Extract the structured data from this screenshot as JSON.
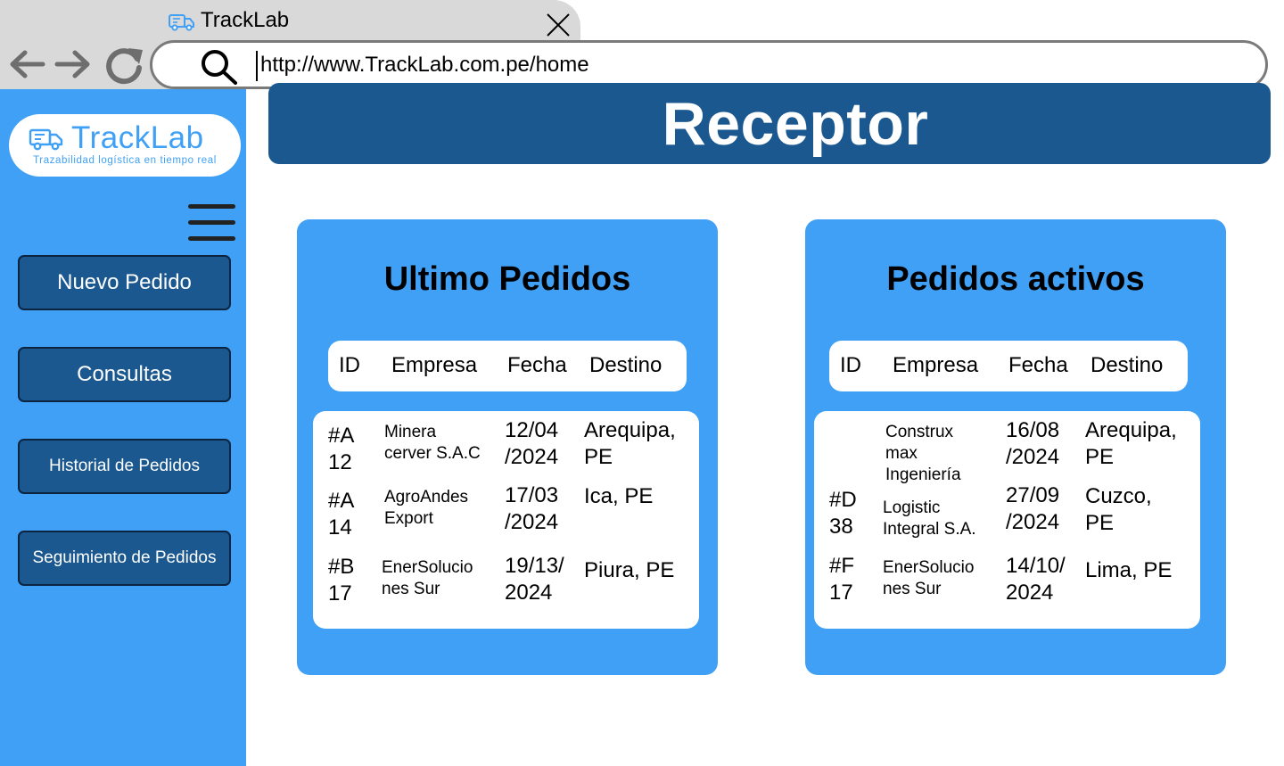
{
  "browser": {
    "tab_title": "TrackLab",
    "url": "http://www.TrackLab.com.pe/home"
  },
  "sidebar": {
    "logo_text": "TrackLab",
    "logo_tagline": "Trazabilidad logística en tiempo real",
    "buttons": [
      {
        "label": "Nuevo Pedido"
      },
      {
        "label": "Consultas"
      },
      {
        "label": "Historial de Pedidos"
      },
      {
        "label": "Seguimiento de Pedidos"
      }
    ]
  },
  "header": {
    "title": "Receptor"
  },
  "ultimos": {
    "title": "Ultimo Pedidos",
    "columns": [
      "ID",
      "Empresa",
      "Fecha",
      "Destino"
    ],
    "rows": [
      {
        "id": "#A\n12",
        "empresa": "Minera\ncerver S.A.C",
        "fecha": "12/04\n/2024",
        "destino": "Arequipa,\nPE"
      },
      {
        "id": "#A\n14",
        "empresa": "AgroAndes\nExport",
        "fecha": "17/03\n/2024",
        "destino": "Ica, PE"
      },
      {
        "id": "#B\n17",
        "empresa": "EnerSolucio\nnes Sur",
        "fecha": "19/13/\n2024",
        "destino": "Piura, PE"
      }
    ]
  },
  "activos": {
    "title": "Pedidos activos",
    "columns": [
      "ID",
      "Empresa",
      "Fecha",
      "Destino"
    ],
    "rows": [
      {
        "id": "",
        "empresa": "Construx\nmax\nIngeniería",
        "fecha": "16/08\n/2024",
        "destino": "Arequipa,\nPE"
      },
      {
        "id": "#D\n38",
        "empresa": "Logistic\nIntegral S.A.",
        "fecha": "27/09\n/2024",
        "destino": "Cuzco,\nPE"
      },
      {
        "id": "#F\n17",
        "empresa": "EnerSolucio\nnes Sur",
        "fecha": "14/10/\n2024",
        "destino": "Lima, PE"
      }
    ]
  },
  "colors": {
    "sidebar_blue": "#40a0f5",
    "dark_blue": "#1b5890",
    "logo_blue": "#3fa0f5"
  },
  "icons": [
    "truck-icon",
    "close-icon",
    "back-arrow-icon",
    "forward-arrow-icon",
    "reload-icon",
    "search-icon",
    "hamburger-menu-icon"
  ]
}
